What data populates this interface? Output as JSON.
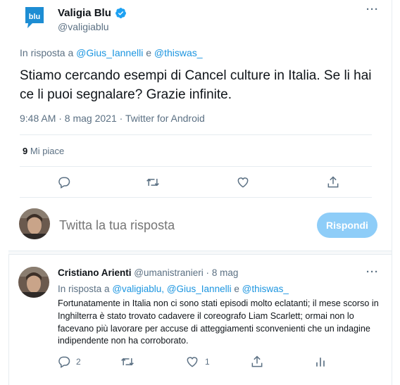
{
  "main_tweet": {
    "author_name": "Valigia Blu",
    "author_handle": "@valigiablu",
    "logo_text": "blu",
    "reply_prefix": "In risposta a",
    "reply_user_1": "@Gius_Iannelli",
    "reply_conj": "e",
    "reply_user_2": "@thiswas_",
    "text": "Stiamo cercando esempi di Cancel culture in Italia. Se li hai ce li puoi segnalare? Grazie infinite.",
    "meta": "9:48 AM · 8 mag 2021 · Twitter for Android",
    "likes_count": "9",
    "likes_label": "Mi piace",
    "more_icon": "···"
  },
  "composer": {
    "placeholder": "Twitta la tua risposta",
    "button_label": "Rispondi"
  },
  "reply_tweet": {
    "author_name": "Cristiano Arienti",
    "author_handle": "@umanistranieri",
    "dot": "·",
    "time": "8 mag",
    "reply_prefix": "In risposta a",
    "reply_user_1": "@valigiablu,",
    "reply_user_2": "@Gius_Iannelli",
    "reply_conj": "e",
    "reply_user_3": "@thiswas_",
    "text": "Fortunatamente in Italia non ci sono stati episodi molto eclatanti; il mese scorso in Inghilterra è stato trovato cadavere il coreografo Liam Scarlett; ormai non lo facevano più lavorare per accuse di atteggiamenti sconvenienti che un indagine indipendente non ha corroborato.",
    "reply_count": "2",
    "like_count": "1",
    "more_icon": "···"
  },
  "colors": {
    "accent": "#1b95e0",
    "logo_blue": "#1d8dd3",
    "secondary_text": "#5b7083",
    "button_disabled": "#8ecdf8",
    "border": "#e6ecf0"
  },
  "icons": {
    "reply": "reply-icon",
    "retweet": "retweet-icon",
    "like": "heart-icon",
    "share": "share-icon",
    "analytics": "analytics-icon",
    "verified": "verified-badge-icon",
    "more": "more-options-icon"
  }
}
